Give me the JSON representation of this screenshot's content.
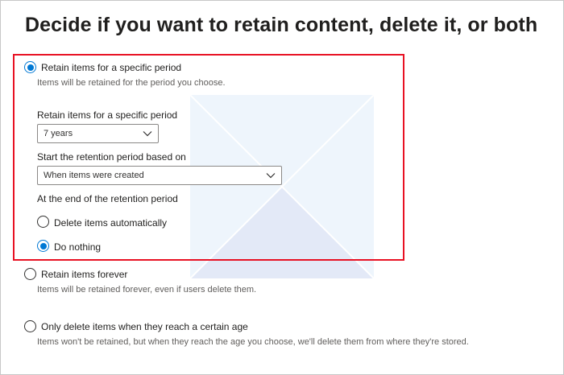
{
  "page": {
    "title": "Decide if you want to retain content, delete it, or both"
  },
  "options": {
    "retain_period": {
      "label": "Retain items for a specific period",
      "description": "Items will be retained for the period you choose.",
      "selected": true
    },
    "retain_forever": {
      "label": "Retain items forever",
      "description": "Items will be retained forever, even if users delete them.",
      "selected": false
    },
    "delete_only": {
      "label": "Only delete items when they reach a certain age",
      "description": "Items won't be retained, but when they reach the age you choose, we'll delete them from where they're stored.",
      "selected": false
    }
  },
  "retention_settings": {
    "period_label": "Retain items for a specific period",
    "period_value": "7 years",
    "start_label": "Start the retention period based on",
    "start_value": "When items were created",
    "end_label": "At the end of the retention period",
    "end_options": {
      "delete_auto": {
        "label": "Delete items automatically",
        "selected": false
      },
      "do_nothing": {
        "label": "Do nothing",
        "selected": true
      }
    }
  },
  "colors": {
    "accent": "#0078d4",
    "highlight": "#e81123"
  },
  "icons": {
    "dropdown": "chevron-down-icon"
  }
}
